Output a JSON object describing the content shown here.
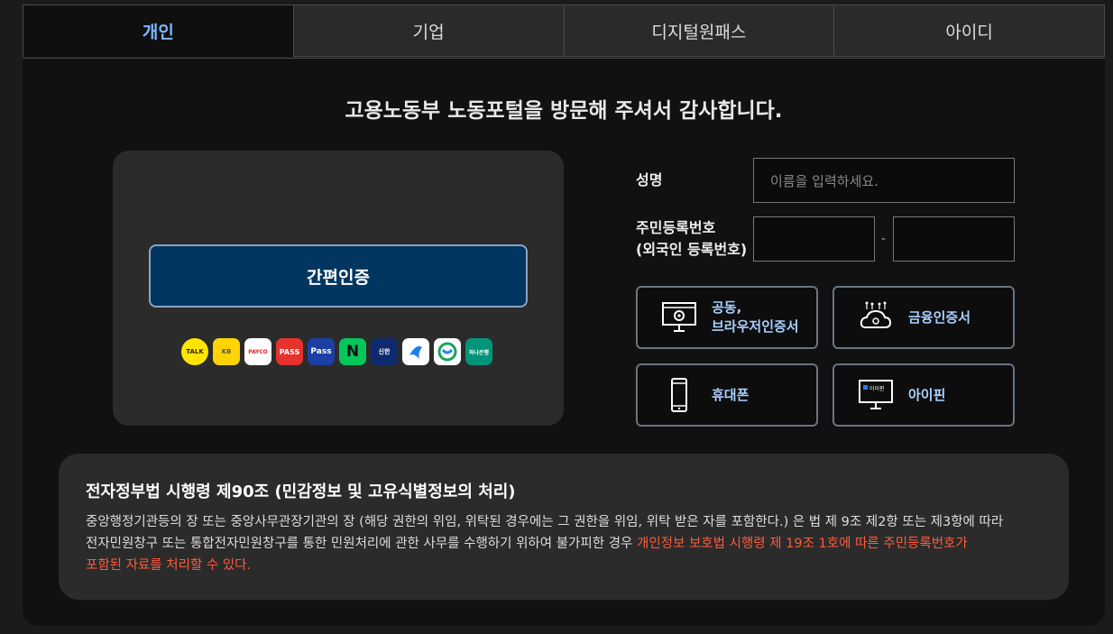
{
  "tabs": [
    {
      "label": "개인",
      "active": true
    },
    {
      "label": "기업",
      "active": false
    },
    {
      "label": "디지털원패스",
      "active": false
    },
    {
      "label": "아이디",
      "active": false
    }
  ],
  "headline": "고용노동부 노동포털을 방문해 주셔서 감사합니다.",
  "easy_auth": {
    "button_label": "간편인증",
    "providers": [
      {
        "icon": "kakaotalk-icon",
        "text": "TALK",
        "bg": "#ffe500"
      },
      {
        "icon": "kb-icon",
        "text": "KB",
        "bg": "#ffd400"
      },
      {
        "icon": "payco-icon",
        "text": "PAYCO",
        "bg": "#ffffff"
      },
      {
        "icon": "pass-icon",
        "text": "PASS",
        "bg": "#e5322d"
      },
      {
        "icon": "samsung-pass-icon",
        "text": "Pass",
        "bg": "#1b3fa5"
      },
      {
        "icon": "naver-icon",
        "text": "N",
        "bg": "#03c75a"
      },
      {
        "icon": "shinhan-icon",
        "text": "신한",
        "bg": "#0d2a6e"
      },
      {
        "icon": "toss-icon",
        "text": "",
        "bg": "#ffffff"
      },
      {
        "icon": "woori-icon",
        "text": "",
        "bg": "#ffffff"
      },
      {
        "icon": "hana-icon",
        "text": "하나은행",
        "bg": "#00957a"
      }
    ]
  },
  "form": {
    "name_label": "성명",
    "name_placeholder": "이름을 입력하세요.",
    "rrn_label_line1": "주민등록번호",
    "rrn_label_line2": "(외국인 등록번호)",
    "rrn_separator": "-"
  },
  "auth_buttons": {
    "joint_cert_line1": "공동,",
    "joint_cert_line2": "브라우저인증서",
    "financial_cert": "금융인증서",
    "mobile": "휴대폰",
    "ipin": "아이핀",
    "ipin_icon_text": "아이핀"
  },
  "notice": {
    "title": "전자정부법 시행령 제90조 (민감정보 및 고유식별정보의 처리)",
    "body_line1": "중앙행정기관등의 장 또는 중앙사무관장기관의 장 (해당 권한의 위임, 위탁된 경우에는 그 권한을 위임, 위탁 받은 자를 포함한다.) 은 법 제 9조 제2항 또는 제3항에 따라",
    "body_line2_plain": "전자민원창구 또는 통합전자민원창구를 통한 민원처리에 관한 사무를 수행하기 위하여 불가피한 경우 ",
    "body_line2_highlight": "개인정보 보호법 시행령 제 19조 1호에 따른 주민등록번호가",
    "body_line3_highlight": "포함된 자료를 처리할 수 있다."
  },
  "colors": {
    "accent_tab": "#7eb6ff",
    "easy_button_bg": "#023660",
    "auth_label": "#a9d0ff",
    "highlight": "#ff5a3c"
  }
}
